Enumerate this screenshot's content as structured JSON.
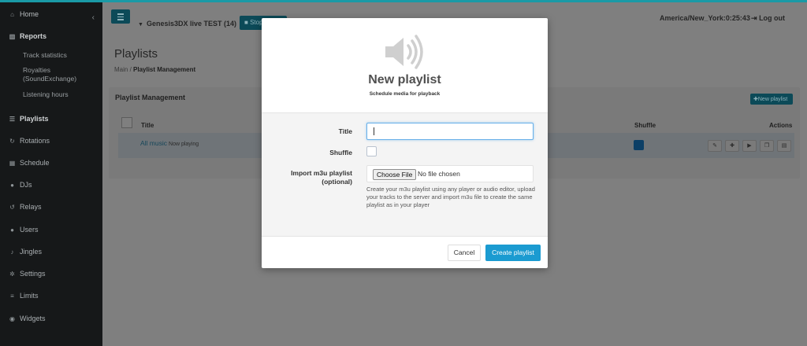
{
  "sidebar": {
    "collapse_icon": "chevron-left-icon",
    "items": [
      {
        "label": "Home",
        "icon": "home-icon"
      },
      {
        "label": "Reports",
        "icon": "bar-chart-icon"
      },
      {
        "label": "Playlists",
        "icon": "list-icon"
      },
      {
        "label": "Rotations",
        "icon": "refresh-icon"
      },
      {
        "label": "Schedule",
        "icon": "calendar-icon"
      },
      {
        "label": "DJs",
        "icon": "user-icon"
      },
      {
        "label": "Relays",
        "icon": "relay-icon"
      },
      {
        "label": "Users",
        "icon": "users-icon"
      },
      {
        "label": "Jingles",
        "icon": "bell-icon"
      },
      {
        "label": "Settings",
        "icon": "cogs-icon"
      },
      {
        "label": "Limits",
        "icon": "limits-icon"
      },
      {
        "label": "Widgets",
        "icon": "widgets-icon"
      }
    ],
    "report_subitems": [
      "Track statistics",
      "Royalties",
      "(SoundExchange)",
      "Listening hours"
    ]
  },
  "header": {
    "station": "Genesis3DX live TEST (14)",
    "stop_label": "Stop",
    "clock": "America/New_York:0:25:43",
    "logout": "Log out"
  },
  "page": {
    "title": "Playlists",
    "breadcrumb_main": "Main",
    "breadcrumb_current": "Playlist Management"
  },
  "card": {
    "title": "Playlist Management",
    "new_button": "New playlist",
    "columns": {
      "title": "Title",
      "shuffle": "Shuffle",
      "actions": "Actions"
    },
    "rows": [
      {
        "title": "All music",
        "status": "Now playing"
      }
    ],
    "action_icons": [
      "edit-icon",
      "plus-icon",
      "play-icon",
      "copy-icon",
      "file-icon"
    ]
  },
  "modal": {
    "icon": "speaker-icon",
    "title": "New playlist",
    "subtitle": "Schedule media for playback",
    "fields": {
      "title_label": "Title",
      "title_value": "",
      "shuffle_label": "Shuffle",
      "import_label_1": "Import m3u playlist",
      "import_label_2": "(optional)",
      "file_button": "Choose File",
      "file_status": "No file chosen",
      "help": "Create your m3u playlist using any player or audio editor, upload your tracks to the server and import m3u file to create the same playlist as in your player"
    },
    "cancel": "Cancel",
    "create": "Create playlist"
  },
  "colors": {
    "accent": "#1b9bd1",
    "sidebar": "#161819",
    "overlay": "#7f7f7f"
  }
}
